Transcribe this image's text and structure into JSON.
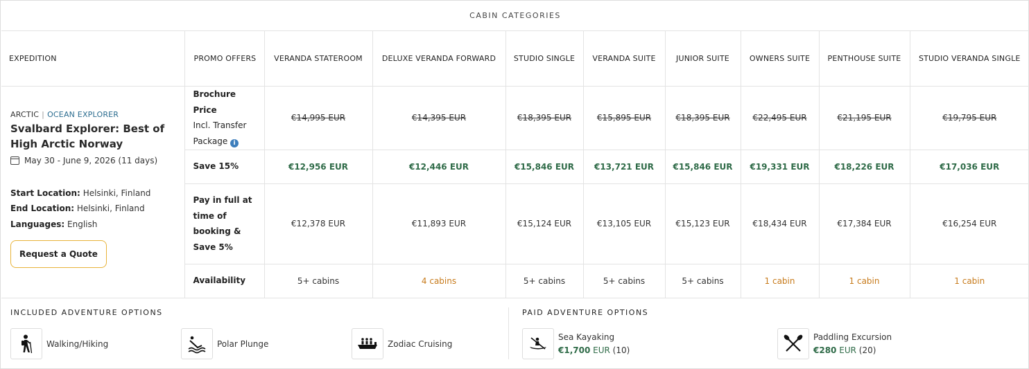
{
  "header": {
    "cabin_categories": "CABIN CATEGORIES"
  },
  "columns": {
    "expedition": "EXPEDITION",
    "promo": "PROMO OFFERS",
    "cabins": [
      "VERANDA STATEROOM",
      "DELUXE VERANDA FORWARD",
      "STUDIO SINGLE",
      "VERANDA SUITE",
      "JUNIOR SUITE",
      "OWNERS SUITE",
      "PENTHOUSE SUITE",
      "STUDIO VERANDA SINGLE"
    ]
  },
  "expedition": {
    "region": "ARCTIC",
    "separator": "|",
    "ship": "OCEAN EXPLORER",
    "title": "Svalbard Explorer: Best of High Arctic Norway",
    "dates": "May 30 - June 9, 2026 (11 days)",
    "start_label": "Start Location:",
    "start_value": "Helsinki, Finland",
    "end_label": "End Location:",
    "end_value": "Helsinki, Finland",
    "languages_label": "Languages:",
    "languages_value": "English",
    "quote_button": "Request a Quote"
  },
  "rows": {
    "brochure": {
      "label_line1": "Brochure Price",
      "label_line2": "Incl. Transfer",
      "label_line3": "Package",
      "info_glyph": "i",
      "values": [
        "€14,995 EUR",
        "€14,395 EUR",
        "€18,395 EUR",
        "€15,895 EUR",
        "€18,395 EUR",
        "€22,495 EUR",
        "€21,195 EUR",
        "€19,795 EUR"
      ]
    },
    "save15": {
      "label": "Save 15%",
      "values": [
        "€12,956 EUR",
        "€12,446 EUR",
        "€15,846 EUR",
        "€13,721 EUR",
        "€15,846 EUR",
        "€19,331 EUR",
        "€18,226 EUR",
        "€17,036 EUR"
      ]
    },
    "payfull": {
      "label_line1": "Pay in full at",
      "label_line2": "time of",
      "label_line3": "booking &",
      "label_line4": "Save 5%",
      "values": [
        "€12,378 EUR",
        "€11,893 EUR",
        "€15,124 EUR",
        "€13,105 EUR",
        "€15,123 EUR",
        "€18,434 EUR",
        "€17,384 EUR",
        "€16,254 EUR"
      ]
    },
    "availability": {
      "label": "Availability",
      "values": [
        "5+ cabins",
        "4 cabins",
        "5+ cabins",
        "5+ cabins",
        "5+ cabins",
        "1 cabin",
        "1 cabin",
        "1 cabin"
      ],
      "limited": [
        false,
        true,
        false,
        false,
        false,
        true,
        true,
        true
      ]
    }
  },
  "included_adventures": {
    "title": "INCLUDED ADVENTURE OPTIONS",
    "items": [
      {
        "label": "Walking/Hiking",
        "icon": "hiking-icon"
      },
      {
        "label": "Polar Plunge",
        "icon": "polar-plunge-icon"
      },
      {
        "label": "Zodiac Cruising",
        "icon": "zodiac-icon"
      }
    ]
  },
  "paid_adventures": {
    "title": "PAID ADVENTURE OPTIONS",
    "items": [
      {
        "label": "Sea Kayaking",
        "amount": "€1,700",
        "currency": "EUR",
        "count": "(10)",
        "icon": "kayak-icon"
      },
      {
        "label": "Paddling Excursion",
        "amount": "€280",
        "currency": "EUR",
        "count": "(20)",
        "icon": "paddles-icon"
      }
    ]
  },
  "colors": {
    "save_green": "#2f6b48",
    "limited_orange": "#c77a1a",
    "ship_blue": "#2b6c8f",
    "button_border": "#e8b339"
  }
}
